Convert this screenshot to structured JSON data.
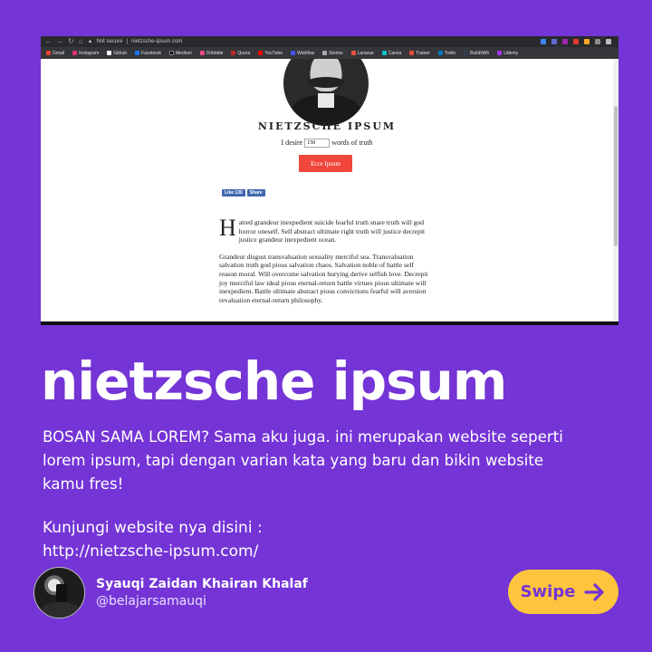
{
  "browser": {
    "security_label": "Not secure",
    "url": "nietzsche-ipsum.com",
    "bookmarks": [
      "Gmail",
      "Instagram",
      "Github",
      "Facebook",
      "Medium",
      "Dribbble",
      "Quora",
      "YouTube",
      "Webflow",
      "Stories",
      "Laravue",
      "Canva",
      "Trainer",
      "Trello",
      "BuildWith",
      "Udemy"
    ]
  },
  "site": {
    "title": "NIETZSCHE IPSUM",
    "desire_prefix": "I desire",
    "desire_value": "150",
    "desire_suffix": "words of truth",
    "button_label": "Ecce Ipsum",
    "fb_like": "Like 130",
    "fb_share": "Share",
    "dropcap": "H",
    "paragraph1": "atred grandeur inexpedient suicide fearful truth snare truth will god horror oneself. Self abstract ultimate right truth will justice decrepit justice grandeur inexpedient ocean.",
    "paragraph2": "Grandeur disgust transvaluation sexuality merciful sea. Transvaluation salvation truth god pious salvation chaos. Salvation noble of battle self reason moral. Will overcome salvation burying derive selfish love. Decrepit joy merciful law ideal pious eternal-return battle virtues pious ultimate will inexpedient. Battle ultimate abstract pious convictions fearful will aversion revaluation eternal-return philosophy."
  },
  "post": {
    "headline": "nietzsche ipsum",
    "description": "BOSAN SAMA LOREM? Sama aku juga. ini merupakan website seperti lorem ipsum, tapi dengan varian kata yang baru dan bikin website kamu fres!",
    "visit_label": "Kunjungi website nya disini :",
    "visit_url": "http://nietzsche-ipsum.com/",
    "author_name": "Syauqi Zaidan Khairan Khalaf",
    "author_handle": "@belajarsamauqi",
    "swipe_label": "Swipe",
    "accent": "#7434d6",
    "button_color": "#ffc43d"
  }
}
